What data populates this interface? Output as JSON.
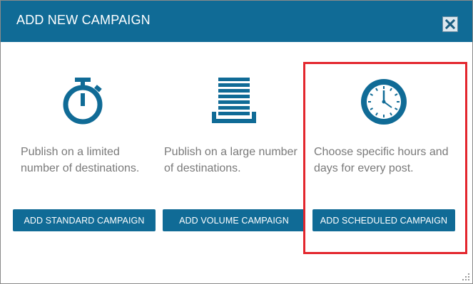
{
  "dialog": {
    "title": "ADD NEW CAMPAIGN",
    "close_icon": "close-icon",
    "accent_color": "#106b96",
    "highlight_color": "#e3262d"
  },
  "options": [
    {
      "icon": "stopwatch-icon",
      "description": "Publish on a limited number of destinations.",
      "button_label": "ADD STANDARD CAMPAIGN"
    },
    {
      "icon": "stack-icon",
      "description": "Publish on a large number of destinations.",
      "button_label": "ADD VOLUME CAMPAIGN"
    },
    {
      "icon": "clock-icon",
      "description": "Choose specific hours and days for every post.",
      "button_label": "ADD SCHEDULED CAMPAIGN"
    }
  ]
}
